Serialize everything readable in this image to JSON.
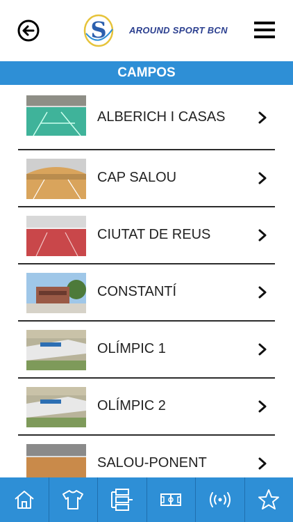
{
  "header": {
    "back_icon": "arrow-left-circle-icon",
    "logo_text": "AROUND SPORT BCN",
    "logo_letter": "S",
    "menu_icon": "hamburger-icon"
  },
  "section": {
    "title": "CAMPOS"
  },
  "items": [
    {
      "label": "ALBERICH I CASAS",
      "thumb": "sports-hall-teal-floor"
    },
    {
      "label": "CAP SALOU",
      "thumb": "sports-hall-wood-floor"
    },
    {
      "label": "CIUTAT DE REUS",
      "thumb": "sports-hall-red-floor"
    },
    {
      "label": "CONSTANTÍ",
      "thumb": "building-exterior"
    },
    {
      "label": "OLÍMPIC 1",
      "thumb": "stadium-aerial"
    },
    {
      "label": "OLÍMPIC 2",
      "thumb": "stadium-aerial"
    },
    {
      "label": "SALOU-PONENT",
      "thumb": "sports-hall-wood-floor"
    }
  ],
  "tabbar": [
    {
      "icon": "home-icon"
    },
    {
      "icon": "jersey-icon"
    },
    {
      "icon": "bracket-icon"
    },
    {
      "icon": "field-icon"
    },
    {
      "icon": "live-broadcast-icon"
    },
    {
      "icon": "star-icon"
    }
  ],
  "colors": {
    "primary": "#2e8fd6",
    "logo_blue": "#2b3f8f",
    "logo_yellow": "#e6c33a"
  }
}
